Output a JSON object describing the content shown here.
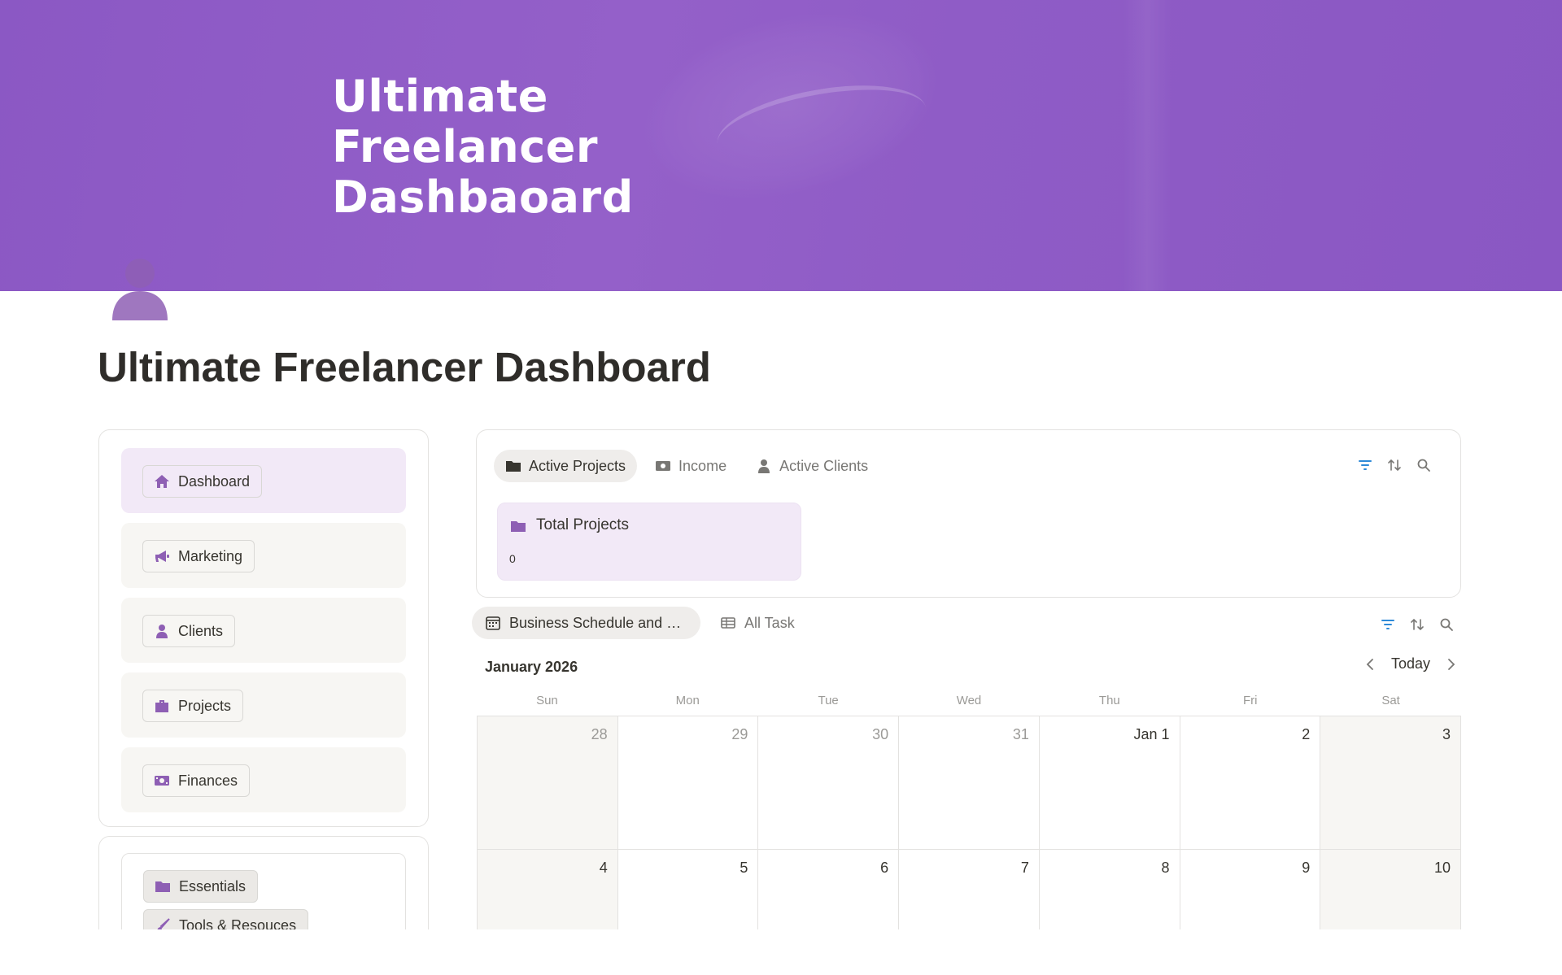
{
  "cover": {
    "title_lines": [
      "Ultimate",
      "Freelancer",
      "Dashbaoard"
    ]
  },
  "page": {
    "title": "Ultimate Freelancer Dashboard",
    "icon": "person-icon"
  },
  "colors": {
    "accent": "#8b58c4",
    "nav_active_bg": "#f2e9f7",
    "nav_bg": "#f7f6f3",
    "icon_purple": "#8e5fb4",
    "toolbar_blue": "#2e8ad8"
  },
  "nav": {
    "items": [
      {
        "label": "Dashboard",
        "icon": "home-icon",
        "active": true
      },
      {
        "label": "Marketing",
        "icon": "megaphone-icon",
        "active": false
      },
      {
        "label": "Clients",
        "icon": "person-icon",
        "active": false
      },
      {
        "label": "Projects",
        "icon": "briefcase-icon",
        "active": false
      },
      {
        "label": "Finances",
        "icon": "money-icon",
        "active": false
      }
    ]
  },
  "resources": {
    "items": [
      {
        "label": "Essentials",
        "icon": "folder-icon"
      },
      {
        "label": "Tools & Resouces",
        "icon": "brush-icon"
      }
    ]
  },
  "stats": {
    "tabs": [
      {
        "label": "Active Projects",
        "icon": "folder-icon",
        "active": true
      },
      {
        "label": "Income",
        "icon": "money-icon",
        "active": false
      },
      {
        "label": "Active Clients",
        "icon": "person-icon",
        "active": false
      }
    ],
    "card": {
      "label": "Total Projects",
      "value": "0",
      "icon": "folder-icon"
    }
  },
  "calendar": {
    "tabs": [
      {
        "label": "Business Schedule and …",
        "icon": "calendar-icon",
        "active": true
      },
      {
        "label": "All Task",
        "icon": "table-icon",
        "active": false
      }
    ],
    "month": "January 2026",
    "today_label": "Today",
    "weekdays": [
      "Sun",
      "Mon",
      "Tue",
      "Wed",
      "Thu",
      "Fri",
      "Sat"
    ],
    "days": [
      {
        "label": "28",
        "outside": true
      },
      {
        "label": "29",
        "outside": true
      },
      {
        "label": "30",
        "outside": true
      },
      {
        "label": "31",
        "outside": true
      },
      {
        "label": "Jan 1",
        "outside": false
      },
      {
        "label": "2",
        "outside": false
      },
      {
        "label": "3",
        "outside": false
      },
      {
        "label": "4",
        "outside": false
      },
      {
        "label": "5",
        "outside": false
      },
      {
        "label": "6",
        "outside": false
      },
      {
        "label": "7",
        "outside": false
      },
      {
        "label": "8",
        "outside": false
      },
      {
        "label": "9",
        "outside": false
      },
      {
        "label": "10",
        "outside": false
      }
    ]
  }
}
